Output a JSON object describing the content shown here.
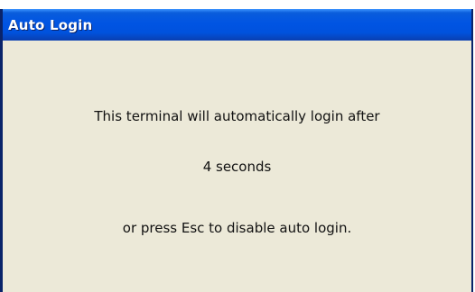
{
  "window": {
    "title": "Auto Login"
  },
  "message": {
    "line1": "This terminal will automatically login after",
    "countdown": "4 seconds",
    "line3": "or press Esc to disable auto login."
  }
}
